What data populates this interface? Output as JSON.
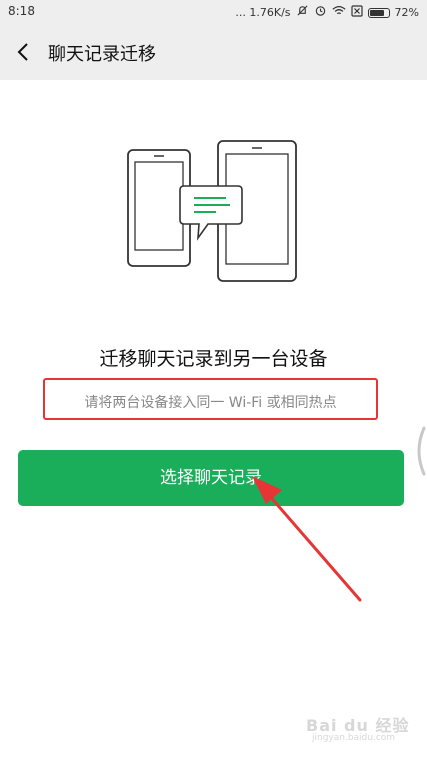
{
  "status_bar": {
    "time": "8:18",
    "network_speed": "... 1.76K/s",
    "battery_percent": "72%",
    "icons": [
      "mute-icon",
      "alarm-icon",
      "wifi-icon",
      "sim-off-icon",
      "battery-icon"
    ]
  },
  "header": {
    "title": "聊天记录迁移",
    "back_icon": "chevron-left-icon"
  },
  "main": {
    "illustration": "phone-to-tablet-chat-transfer",
    "title": "迁移聊天记录到另一台设备",
    "hint": "请将两台设备接入同一 Wi-Fi 或相同热点",
    "primary_button": "选择聊天记录"
  },
  "colors": {
    "primary_green": "#1aad5a",
    "annotation_red": "#e63535",
    "header_bg": "#eeeeee"
  },
  "watermark": {
    "main": "Bai du 经验",
    "sub": "jingyan.baidu.com"
  }
}
